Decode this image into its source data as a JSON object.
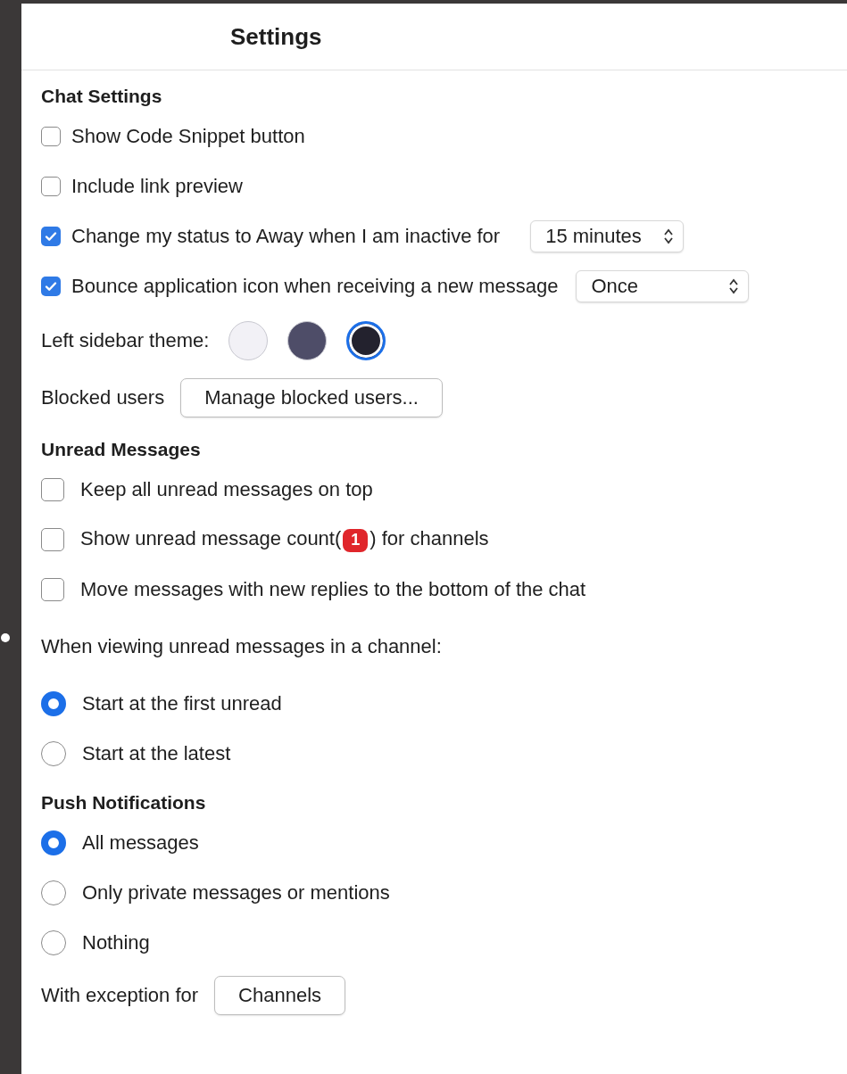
{
  "title": "Settings",
  "sections": [
    {
      "heading": "Chat Settings",
      "items": [
        {
          "kind": "checkbox",
          "label": "Show Code Snippet button",
          "checked": false
        },
        {
          "kind": "checkbox",
          "label": "Include link preview",
          "checked": false
        },
        {
          "kind": "checkbox",
          "label": "Change my status to Away when I am inactive for",
          "checked": true,
          "select": "15 minutes"
        },
        {
          "kind": "checkbox",
          "label": "Bounce application icon when receiving a new message",
          "checked": true,
          "select": "Once"
        },
        {
          "kind": "theme",
          "label": "Left sidebar theme:",
          "swatches": [
            {
              "color": "#f2f1f6",
              "selected": false
            },
            {
              "color": "#4e4d68",
              "selected": false
            },
            {
              "color": "#23222e",
              "selected": true
            }
          ]
        },
        {
          "kind": "button",
          "label": "Blocked users",
          "button": "Manage blocked users..."
        }
      ]
    },
    {
      "heading": "Unread Messages",
      "items": [
        {
          "kind": "checkbox",
          "label": "Keep all unread messages on top",
          "checked": false
        },
        {
          "kind": "checkbox",
          "label": "Show unread message count(",
          "badge": "1",
          "label_after": ") for channels",
          "checked": false
        },
        {
          "kind": "checkbox",
          "label": "Move messages with new replies to the bottom of the chat",
          "checked": false
        },
        {
          "kind": "text",
          "label": "When viewing unread messages in a channel:"
        },
        {
          "kind": "radio",
          "label": "Start at the first unread",
          "selected": true
        },
        {
          "kind": "radio",
          "label": "Start at the latest",
          "selected": false
        }
      ]
    },
    {
      "heading": "Push Notifications",
      "items": [
        {
          "kind": "radio",
          "label": "All messages",
          "selected": true
        },
        {
          "kind": "radio",
          "label": "Only private messages or mentions",
          "selected": false
        },
        {
          "kind": "radio",
          "label": "Nothing",
          "selected": false
        },
        {
          "kind": "button",
          "label": "With exception for",
          "button": "Channels"
        }
      ]
    }
  ]
}
